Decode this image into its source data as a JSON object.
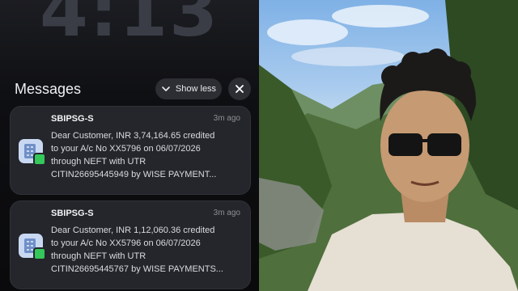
{
  "lockscreen": {
    "time": "4:13"
  },
  "notifications": {
    "header": "Messages",
    "show_less_label": "Show less",
    "items": [
      {
        "sender": "SBIPSG-S",
        "time": "3m ago",
        "lines": [
          "Dear Customer, INR 3,74,164.65 credited",
          "to your A/c No XX5796 on 06/07/2026",
          "through NEFT with UTR",
          "CITIN26695445949 by WISE PAYMENT..."
        ]
      },
      {
        "sender": "SBIPSG-S",
        "time": "3m ago",
        "lines": [
          "Dear Customer, INR 1,12,060.36 credited",
          "to your A/c No XX5796 on 06/07/2026",
          "through NEFT with UTR",
          "CITIN26695445767 by WISE PAYMENTS..."
        ]
      }
    ]
  },
  "colors": {
    "accent_green": "#34c759",
    "card_bg": "#24262b"
  }
}
